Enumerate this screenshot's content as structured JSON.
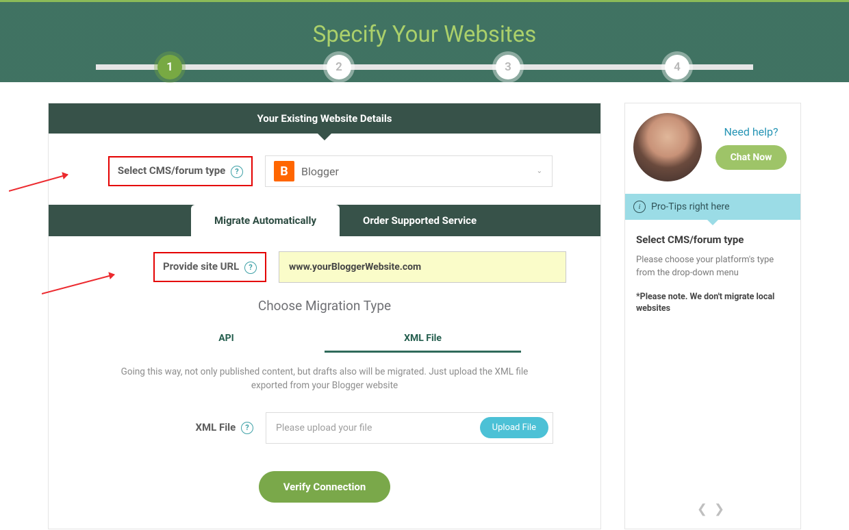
{
  "hero": {
    "title": "Specify Your Websites"
  },
  "steps": [
    "1",
    "2",
    "3",
    "4"
  ],
  "active_step": 1,
  "panel": {
    "title": "Your Existing Website Details",
    "cms": {
      "label": "Select CMS/forum type",
      "selected": "Blogger"
    },
    "tabs": {
      "auto": "Migrate Automatically",
      "supported": "Order Supported Service"
    },
    "url": {
      "label": "Provide site URL",
      "value": "www.yourBloggerWebsite.com"
    },
    "migration": {
      "heading": "Choose Migration Type",
      "api": "API",
      "xml": "XML File",
      "desc": "Going this way, not only published content, but drafts also will be migrated. Just upload the XML file exported from your Blogger website"
    },
    "file": {
      "label": "XML File",
      "placeholder": "Please upload your file",
      "button": "Upload File"
    },
    "verify": "Verify Connection"
  },
  "sidebar": {
    "need_help": "Need help?",
    "chat": "Chat Now",
    "pro_label": "Pro-Tips right here",
    "tip_title": "Select CMS/forum type",
    "tip_body": "Please choose your platform's type from the drop-down menu",
    "tip_note": "*Please note. We don't migrate local websites"
  }
}
